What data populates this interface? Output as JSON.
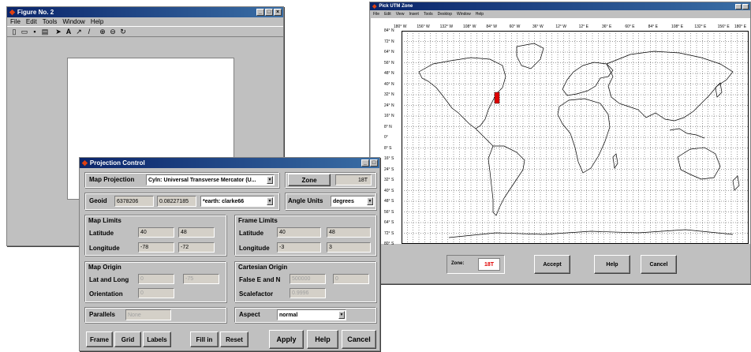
{
  "figure2": {
    "title": "Figure No. 2",
    "menus": [
      "File",
      "Edit",
      "Tools",
      "Window",
      "Help"
    ],
    "toolbar_icons": [
      "new-icon",
      "open-icon",
      "save-icon",
      "print-icon",
      "pointer-icon",
      "text-icon",
      "arrow-icon",
      "line-icon",
      "zoom-in-icon",
      "zoom-out-icon",
      "rotate-icon"
    ]
  },
  "utm": {
    "title": "Pick UTM Zone",
    "menus": [
      "File",
      "Edit",
      "View",
      "Insert",
      "Tools",
      "Desktop",
      "Window",
      "Help"
    ],
    "lon_labels": [
      "180° W",
      "156° W",
      "132° W",
      "108° W",
      "84° W",
      "60° W",
      "36° W",
      "12° W",
      "12° E",
      "36° E",
      "60° E",
      "84° E",
      "108° E",
      "132° E",
      "156° E",
      "180° E"
    ],
    "lat_labels": [
      "84° N",
      "72° N",
      "64° N",
      "56° N",
      "48° N",
      "40° N",
      "32° N",
      "24° N",
      "16° N",
      "8° N",
      "0°",
      "8° S",
      "16° S",
      "24° S",
      "32° S",
      "40° S",
      "48° S",
      "56° S",
      "64° S",
      "72° S",
      "80° S"
    ],
    "zone_label": "Zone:",
    "zone_value": "18T",
    "accept": "Accept",
    "help": "Help",
    "cancel": "Cancel",
    "highlight_color": "#e00000"
  },
  "proj": {
    "title": "Projection Control",
    "map_projection_label": "Map Projection",
    "map_projection_value": "Cyln: Universal Transverse Mercator (U...",
    "zone_button": "Zone",
    "zone_value": "18T",
    "geoid_label": "Geoid",
    "geoid_a": "6378206",
    "geoid_e": "0.08227185",
    "geoid_name": "*earth: clarke66",
    "angle_units_label": "Angle Units",
    "angle_units_value": "degrees",
    "map_limits": {
      "title": "Map Limits",
      "lat_label": "Latitude",
      "lat_min": "40",
      "lat_max": "48",
      "lon_label": "Longitude",
      "lon_min": "-78",
      "lon_max": "-72"
    },
    "frame_limits": {
      "title": "Frame Limits",
      "lat_label": "Latitude",
      "lat_min": "40",
      "lat_max": "48",
      "lon_label": "Longitude",
      "lon_min": "-3",
      "lon_max": "3"
    },
    "map_origin": {
      "title": "Map Origin",
      "latlong_label": "Lat and Long",
      "lat": "0",
      "lon": "-75",
      "orient_label": "Orientation",
      "orient": "0"
    },
    "cart_origin": {
      "title": "Cartesian Origin",
      "fe_label": "False E and N",
      "fe": "500000",
      "fn": "0",
      "scale_label": "Scalefactor",
      "scale": "0.9996"
    },
    "parallels_label": "Parallels",
    "parallels_value": "None",
    "aspect_label": "Aspect",
    "aspect_value": "normal",
    "buttons": {
      "frame": "Frame",
      "grid": "Grid",
      "labels": "Labels",
      "fillin": "Fill in",
      "reset": "Reset",
      "apply": "Apply",
      "help": "Help",
      "cancel": "Cancel"
    }
  }
}
